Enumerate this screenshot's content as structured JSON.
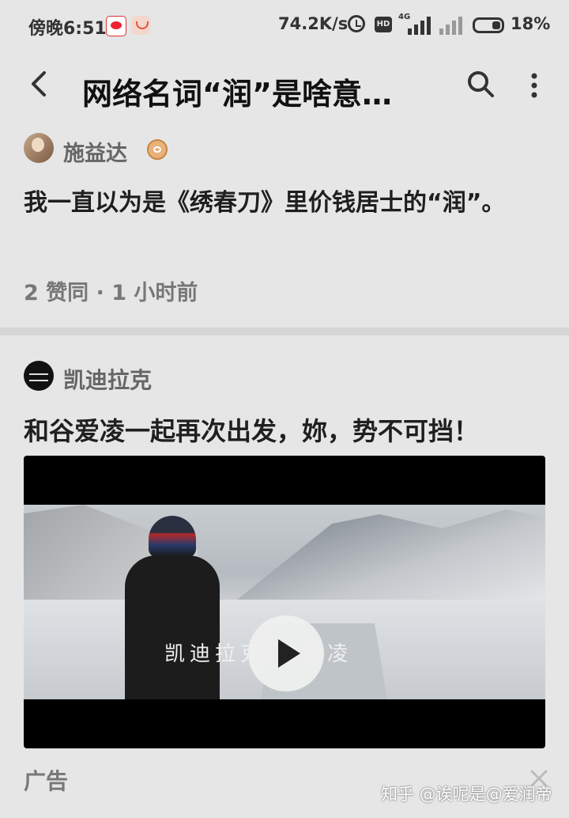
{
  "status_bar": {
    "time": "傍晚6:51",
    "net_speed": "74.2K/s",
    "hd_label": "HD",
    "network_type": "4G",
    "battery": "18%"
  },
  "app_bar": {
    "title": "网络名词“润”是啥意…"
  },
  "comment": {
    "author": "施益达",
    "text": "我一直以为是《绣春刀》里价钱居士的“润”。",
    "meta": "2 赞同 · 1 小时前"
  },
  "ad": {
    "brand": "凯迪拉克",
    "headline": "和谷爱凌一起再次出发，妳，势不可挡！",
    "video_caption": "凯迪拉克 谷爱凌",
    "label": "广告"
  },
  "watermark": "知乎 @诶呢是@爱润帝"
}
